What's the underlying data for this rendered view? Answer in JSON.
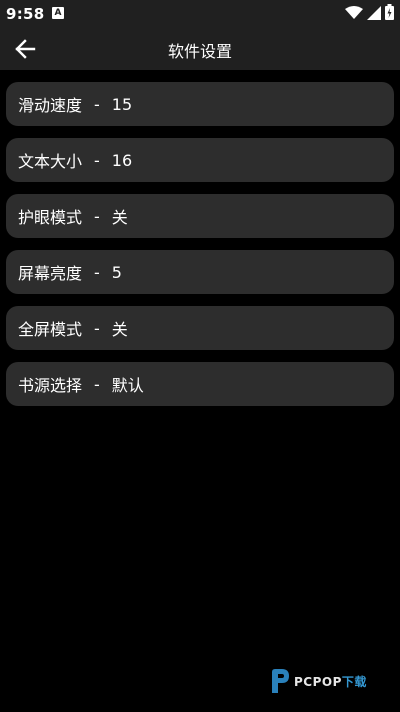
{
  "status_bar": {
    "time": "9:58",
    "notification_glyph": "A",
    "icons": [
      "wifi-icon",
      "signal-icon",
      "battery-icon"
    ]
  },
  "app_bar": {
    "title": "软件设置",
    "back_icon": "back-arrow-icon"
  },
  "settings": [
    {
      "label": "滑动速度",
      "separator": "-",
      "value": "15"
    },
    {
      "label": "文本大小",
      "separator": "-",
      "value": "16"
    },
    {
      "label": "护眼模式",
      "separator": "-",
      "value": "关"
    },
    {
      "label": "屏幕亮度",
      "separator": "-",
      "value": "5"
    },
    {
      "label": "全屏模式",
      "separator": "-",
      "value": "关"
    },
    {
      "label": "书源选择",
      "separator": "-",
      "value": "默认"
    }
  ],
  "watermark": {
    "text": "PCPOP",
    "accent_text": "下载",
    "logo": "pcpop-logo-icon"
  },
  "colors": {
    "background": "#000000",
    "bar": "#202020",
    "item": "#2d2d2d",
    "text": "#ffffff",
    "watermark_accent": "#3aa8e8"
  }
}
